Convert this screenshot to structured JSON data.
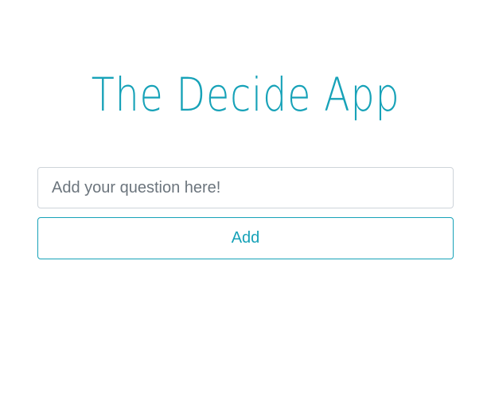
{
  "app": {
    "title": "The Decide App"
  },
  "form": {
    "question_placeholder": "Add your question here!",
    "question_value": "",
    "add_label": "Add"
  },
  "colors": {
    "accent": "#17a2b8",
    "input_border": "#ced4da",
    "placeholder": "#6c757d",
    "background": "#ffffff"
  }
}
